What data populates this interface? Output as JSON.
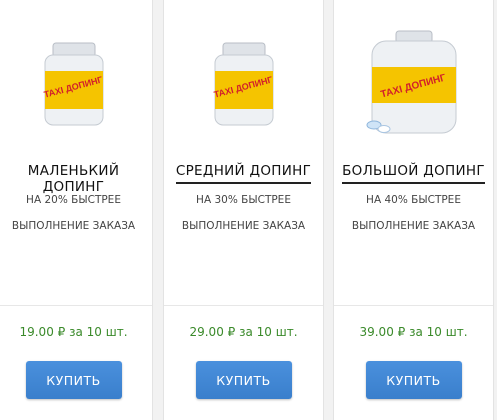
{
  "products": [
    {
      "title": "МАЛЕНЬКИЙ ДОПИНГ",
      "desc_line1": "НА 20% БЫСТРЕЕ",
      "desc_line2": "ВЫПОЛНЕНИЕ ЗАКАЗА",
      "price": "19.00 ₽ за 10 шт.",
      "buy_label": "КУПИТЬ",
      "jar_label": "TAXI ДОПИНГ"
    },
    {
      "title": "СРЕДНИЙ ДОПИНГ",
      "desc_line1": "НА 30% БЫСТРЕЕ",
      "desc_line2": "ВЫПОЛНЕНИЕ ЗАКАЗА",
      "price": "29.00 ₽ за 10 шт.",
      "buy_label": "КУПИТЬ",
      "jar_label": "TAXI ДОПИНГ"
    },
    {
      "title": "БОЛЬШОЙ ДОПИНГ",
      "desc_line1": "НА 40% БЫСТРЕЕ",
      "desc_line2": "ВЫПОЛНЕНИЕ ЗАКАЗА",
      "price": "39.00 ₽ за 10 шт.",
      "buy_label": "КУПИТЬ",
      "jar_label": "TAXI ДОПИНГ"
    }
  ],
  "colors": {
    "price_green": "#3a8a2a",
    "button_blue": "#3f86d4",
    "label_yellow": "#f5c400"
  }
}
